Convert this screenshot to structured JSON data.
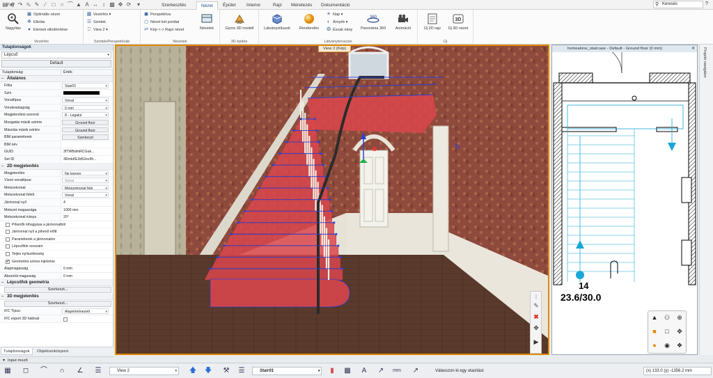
{
  "menubar": {
    "tabs": [
      "Fájl",
      "Szerkesztés",
      "Nézet",
      "Épület",
      "Interior",
      "Rajz",
      "Méretezés",
      "Dokumentáció"
    ],
    "active_tab": "Nézet",
    "search_placeholder": "Keresés"
  },
  "ribbon": {
    "groups": [
      {
        "label": "Vezérlés"
      },
      {
        "label": "Szintek/Perspektívák"
      },
      {
        "label": "Nézetek"
      },
      {
        "label": "3D építés"
      },
      {
        "label": "Látványtervezés"
      },
      {
        "label": "Új"
      }
    ],
    "vezerles": {
      "big": "Nagyítás",
      "small": [
        "Optimális nézet",
        "Eltolás",
        "Elemek elkülönítése"
      ]
    },
    "szintek": {
      "small": [
        "Vezérlés",
        "Szintek",
        "View 2"
      ]
    },
    "nezetek": {
      "small": [
        "Perspektíva",
        "Nézet két ponttal",
        "Kép <-> Rajzi nézet"
      ],
      "big": "Nézetek"
    },
    "epites": {
      "big": "Gyors 3D modell"
    },
    "latvany": {
      "big": [
        "Látványstílusok",
        "Renderelés",
        "Panoráma 360",
        "Animáció"
      ],
      "small": [
        "Nap",
        "Árnyék",
        "Észak irány"
      ]
    },
    "uj": {
      "big": [
        "Új 2D rajz",
        "Új 3D nézet"
      ]
    }
  },
  "left_panel": {
    "title": "Tulajdonságok",
    "selector": "Lépcső",
    "default_button": "Default",
    "col_property": "Tulajdonság",
    "col_value": "Érték",
    "sec_general": "Általános",
    "general": [
      {
        "name": "Fólia",
        "value": "Stair01",
        "kind": "dd"
      },
      {
        "name": "Szín",
        "value": "",
        "kind": "swatch"
      },
      {
        "name": "Vonaltípus",
        "value": "Vonal",
        "kind": "dd"
      },
      {
        "name": "Vonalvastagság",
        "value": "0 mm",
        "kind": "dd"
      },
      {
        "name": "Megjelenítési sorrend",
        "value": "8 - Legalul",
        "kind": "dd"
      },
      {
        "name": "Mozgatás másik szintre",
        "value": "Ground floor",
        "kind": "btn"
      },
      {
        "name": "Másolás másik szintre",
        "value": "Ground floor",
        "kind": "btn"
      },
      {
        "name": "BIM paraméterek",
        "value": "Szerkeszt",
        "kind": "btn"
      },
      {
        "name": "BIM név",
        "value": "",
        "kind": "text"
      },
      {
        "name": "GUID",
        "value": "3fTWBdmRCGuk...",
        "kind": "text"
      },
      {
        "name": "Set ID",
        "value": "3RmkKE3d52ev9h...",
        "kind": "text"
      }
    ],
    "sec_2d": "2D megjelenítés",
    "display2d": [
      {
        "name": "Megjelenítés",
        "value": "Ne legyen",
        "kind": "dd"
      },
      {
        "name": "Vízori vonaltípus:",
        "value": "Vonal",
        "kind": "dd-dim"
      },
      {
        "name": "Metszetvonal",
        "value": "Metszetvonal fele",
        "kind": "dd"
      },
      {
        "name": "Metszetvonal felett",
        "value": "Vonal",
        "kind": "dd"
      },
      {
        "name": "Járóvonal nyíl",
        "value": "4",
        "kind": "text"
      },
      {
        "name": "Metszet magassága",
        "value": "1000 mm",
        "kind": "text"
      },
      {
        "name": "Metszetvonal iránya",
        "value": "20°",
        "kind": "text"
      }
    ],
    "checks": [
      {
        "label": "Pihenők kihagyása a járóvonalból",
        "checked": false
      },
      {
        "label": "Járóvonal nyíl a pihenő előtt",
        "checked": false
      },
      {
        "label": "Paraméterek a járóvonalon",
        "checked": false
      },
      {
        "label": "Lépcsőfok sorszám",
        "checked": false
      },
      {
        "label": "Teljes nyílszélesség",
        "checked": false
      },
      {
        "label": "Geometria színes kijelzése",
        "checked": true
      }
    ],
    "heights": [
      {
        "name": "Alapmagasság",
        "value": "0 mm"
      },
      {
        "name": "Abszolút magasság",
        "value": "0 mm"
      }
    ],
    "sec_steps": "Lépcsőfok geometria",
    "edit_button": "Szerkeszt...",
    "sec_3d": "3D megjelenítés",
    "ifc_type_label": "IFC Típus:",
    "ifc_type_value": "Alapértelmezett",
    "ifc_export_label": "IFC export 3D hálóval",
    "tabs": [
      "Tulajdonságok",
      "Objektumközpont"
    ]
  },
  "view3d": {
    "tab": "View 2 (Kép)"
  },
  "plan": {
    "tab": "homealone_staircase - Default - Ground floor (0 mm)",
    "step_count": "14",
    "step_ratio": "23.6/30.0"
  },
  "right_sidebar": {
    "label": "Projekt navigátor"
  },
  "bottom": {
    "input_label": "Input mező",
    "view_combo": "View 2",
    "layer_combo": "Stair01",
    "status": "Válasszon ki egy utasítást",
    "coords": "(x) 133.0  (y) -1356.2 mm"
  },
  "colors": {
    "accent": "#e08a00",
    "stair_red": "#d9474c",
    "selection": "#2b3fd6",
    "plan_cyan": "#18a7d6"
  }
}
